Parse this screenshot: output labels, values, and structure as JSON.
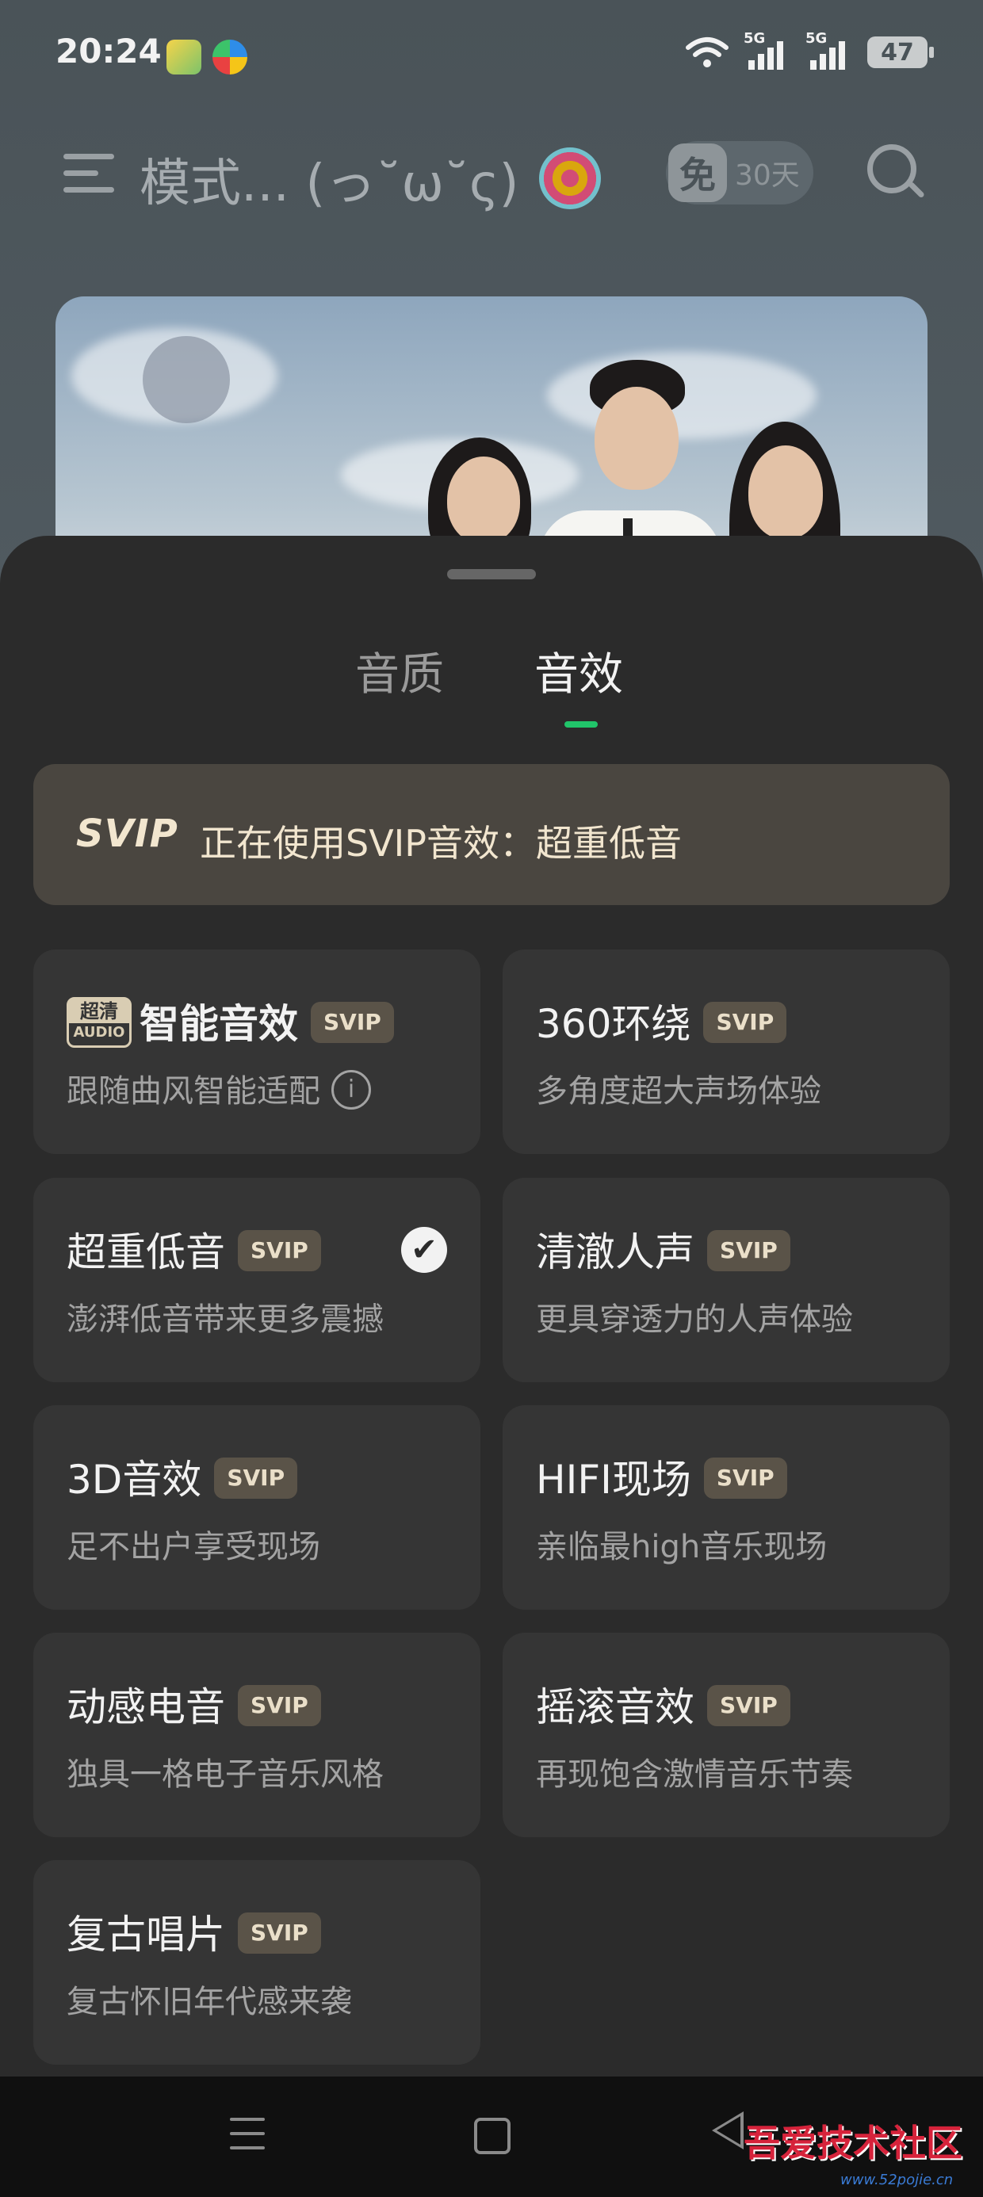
{
  "status_bar": {
    "time": "20:24",
    "network_label_1": "5G",
    "network_label_2": "5G",
    "battery": "47"
  },
  "header": {
    "title": "模式... (っ˘ω˘ς)",
    "free_badge_mark": "免",
    "free_badge_days": "30天"
  },
  "sheet": {
    "tabs": [
      {
        "label": "音质",
        "active": false
      },
      {
        "label": "音效",
        "active": true
      }
    ],
    "notice": {
      "logo": "SVIP",
      "text": "正在使用SVIP音效：超重低音"
    },
    "uhd_mark": {
      "top": "超清",
      "bottom": "AUDIO"
    },
    "effects": [
      {
        "title": "智能音效",
        "badge": "SVIP",
        "subtitle": "跟随曲风智能适配",
        "info": "i"
      },
      {
        "title": "360环绕",
        "badge": "SVIP",
        "subtitle": "多角度超大声场体验"
      },
      {
        "title": "超重低音",
        "badge": "SVIP",
        "subtitle": "澎湃低音带来更多震撼",
        "selected": true
      },
      {
        "title": "清澈人声",
        "badge": "SVIP",
        "subtitle": "更具穿透力的人声体验"
      },
      {
        "title": "3D音效",
        "badge": "SVIP",
        "subtitle": "足不出户享受现场"
      },
      {
        "title": "HIFI现场",
        "badge": "SVIP",
        "subtitle": "亲临最high音乐现场"
      },
      {
        "title": "动感电音",
        "badge": "SVIP",
        "subtitle": "独具一格电子音乐风格"
      },
      {
        "title": "摇滚音效",
        "badge": "SVIP",
        "subtitle": "再现饱含激情音乐节奏"
      },
      {
        "title": "复古唱片",
        "badge": "SVIP",
        "subtitle": "复古怀旧年代感来袭"
      }
    ]
  },
  "watermark": {
    "text": "吾爱技术社区",
    "url": "www.52pojie.cn"
  },
  "colors": {
    "accent": "#21c56a",
    "sheet_bg": "#2b2b2b",
    "card_bg": "#353535",
    "svip_gold": "#eadfc9"
  },
  "icons": [
    "menu-icon",
    "lollipop-icon",
    "search-icon",
    "info-icon",
    "check-icon",
    "nav-menu-icon",
    "nav-home-icon",
    "nav-back-icon"
  ]
}
